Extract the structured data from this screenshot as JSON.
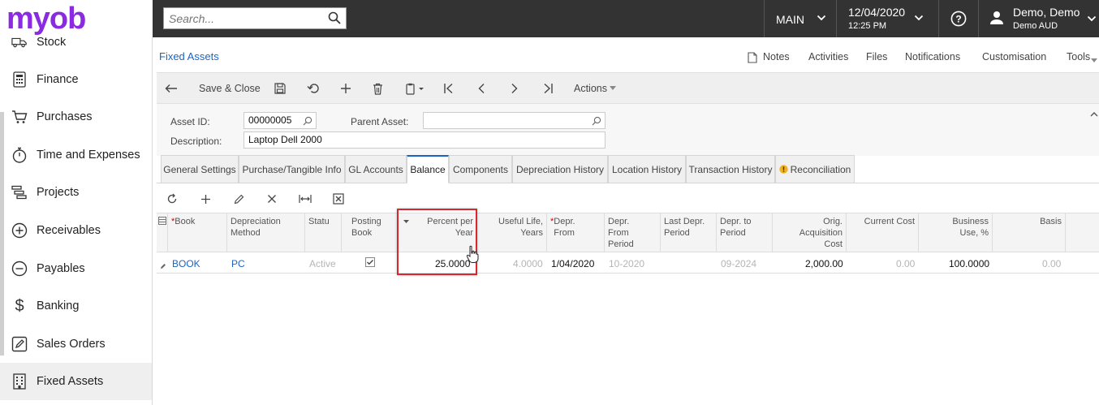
{
  "logo": "myob",
  "sidebar": {
    "items": [
      {
        "label": "Stock",
        "icon": "truck-icon"
      },
      {
        "label": "Finance",
        "icon": "calculator-icon"
      },
      {
        "label": "Purchases",
        "icon": "cart-icon"
      },
      {
        "label": "Time and Expenses",
        "icon": "stopwatch-icon"
      },
      {
        "label": "Projects",
        "icon": "gantt-icon"
      },
      {
        "label": "Receivables",
        "icon": "plus-circle-icon"
      },
      {
        "label": "Payables",
        "icon": "minus-circle-icon"
      },
      {
        "label": "Banking",
        "icon": "dollar-icon"
      },
      {
        "label": "Sales Orders",
        "icon": "edit-box-icon"
      },
      {
        "label": "Fixed Assets",
        "icon": "building-icon"
      }
    ],
    "active": "Fixed Assets"
  },
  "topbar": {
    "search_placeholder": "Search...",
    "branch": "MAIN",
    "date": "12/04/2020",
    "time": "12:25 PM",
    "user_name": "Demo, Demo",
    "company": "Demo AUD"
  },
  "page": {
    "title": "Fixed Assets",
    "links": {
      "notes": "Notes",
      "activities": "Activities",
      "files": "Files",
      "notifications": "Notifications",
      "customisation": "Customisation",
      "tools": "Tools"
    }
  },
  "toolbar": {
    "save_close": "Save & Close",
    "actions": "Actions"
  },
  "form": {
    "asset_id_label": "Asset ID:",
    "asset_id": "00000005",
    "parent_asset_label": "Parent Asset:",
    "parent_asset": "",
    "description_label": "Description:",
    "description": "Laptop Dell 2000"
  },
  "tabs": [
    "General Settings",
    "Purchase/Tangible Info",
    "GL Accounts",
    "Balance",
    "Components",
    "Depreciation History",
    "Location History",
    "Transaction History",
    "Reconciliation"
  ],
  "active_tab": "Balance",
  "grid": {
    "headers": {
      "book": "Book",
      "method": "Depreciation Method",
      "status": "Statu",
      "posting": "Posting Book",
      "percent": "Percent per Year",
      "useful_life": "Useful Life, Years",
      "depr_from": "Depr. From",
      "depr_from_period": "Depr. From Period",
      "last_depr_period": "Last Depr. Period",
      "depr_to_period": "Depr. to Period",
      "orig_cost": "Orig. Acquisition Cost",
      "current_cost": "Current Cost",
      "business_use": "Business Use, %",
      "basis": "Basis"
    },
    "row": {
      "book": "BOOK",
      "method": "PC",
      "status": "Active",
      "posting": true,
      "percent": "25.0000",
      "useful_life": "4.0000",
      "depr_from": "1/04/2020",
      "depr_from_period": "10-2020",
      "last_depr_period": "",
      "depr_to_period": "09-2024",
      "orig_cost": "2,000.00",
      "current_cost": "0.00",
      "business_use": "100.0000",
      "basis": "0.00"
    }
  },
  "colors": {
    "topbar": "#333333",
    "accent": "#1a64c4",
    "logo": "#8a2be2",
    "highlight": "#d9272e"
  }
}
